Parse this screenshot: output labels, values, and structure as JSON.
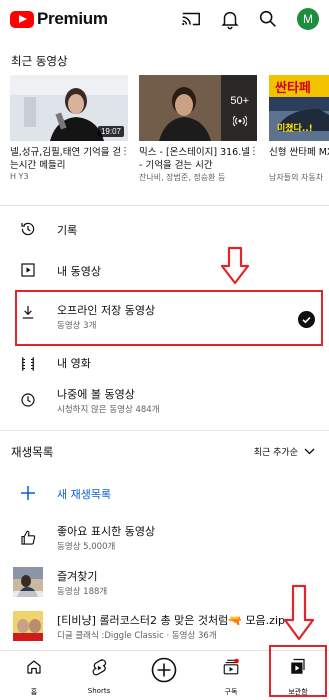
{
  "header": {
    "logo_text": "Premium",
    "avatar_letter": "M"
  },
  "recent": {
    "title": "최근 동영상",
    "videos": [
      {
        "title": "넬,성규,김필,태연 기억을 걷는시간 메들리",
        "channel": "H Y3",
        "duration": "19:07"
      },
      {
        "title": "믹스 - [온스테이지] 316.넬 - 기억을 걷는 시간",
        "channel": "잔나비, 장범준, 정승환 등",
        "overlay": "50+"
      },
      {
        "title": "신형 싼타페 MX5를 기다려",
        "channel": "남자들의 자동차",
        "thumb_text_1": "싼타페",
        "thumb_text_2": "미쳤다..!"
      }
    ]
  },
  "library": {
    "items": [
      {
        "label": "기록"
      },
      {
        "label": "내 동영상"
      },
      {
        "label": "오프라인 저장 동영상",
        "sub": "동영상 3개"
      },
      {
        "label": "내 영화"
      },
      {
        "label": "나중에 볼 동영상",
        "sub": "시청하지 않은 동영상 484개"
      }
    ]
  },
  "playlists": {
    "title": "재생목록",
    "sort_label": "최근 추가순",
    "new_label": "새 재생목록",
    "items": [
      {
        "label": "좋아요 표시한 동영상",
        "sub": "동영상 5,000개"
      },
      {
        "label": "즐겨찾기",
        "sub": "동영상 188개"
      },
      {
        "label": "[티비냥] 롤러코스터2 총 맞은 것처럼🔫 모음.zip",
        "sub": "디글 클래식 :Diggle Classic · 동영상 36개"
      }
    ]
  },
  "nav": {
    "home": "홈",
    "shorts": "Shorts",
    "subscriptions": "구독",
    "library": "보관함"
  },
  "colors": {
    "brand_red": "#ff0000",
    "annotation_red": "#e0262b",
    "link_blue": "#065fd4"
  }
}
